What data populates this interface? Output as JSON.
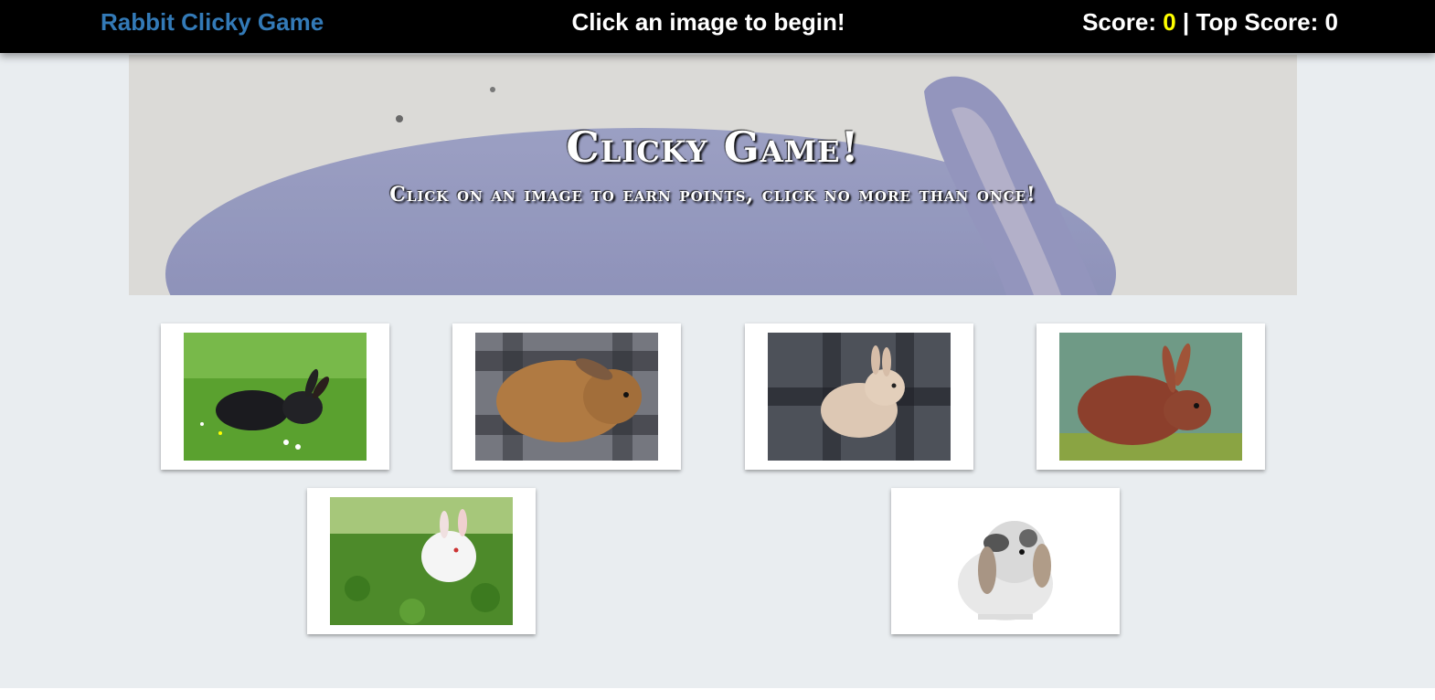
{
  "navbar": {
    "brand": "Rabbit Clicky Game",
    "message": "Click an image to begin!",
    "score_label": "Score: ",
    "score_value": "0",
    "separator": " | ",
    "top_score_label": "Top Score: ",
    "top_score_value": "0"
  },
  "hero": {
    "title": "Clicky Game!",
    "subtitle": "Click on an image to earn points, click no more than once!"
  },
  "cards": [
    {
      "name": "black rabbit on grass"
    },
    {
      "name": "brown rabbit on plaid blanket"
    },
    {
      "name": "cream rabbit on plaid blanket"
    },
    {
      "name": "red-brown rabbit on moss"
    },
    {
      "name": "white bunny in clover"
    },
    {
      "name": "grey and white lop rabbit"
    }
  ],
  "colors": {
    "brand": "#337ab7",
    "score": "#ffff00",
    "navbar": "#000000",
    "background": "#e9edf0"
  }
}
